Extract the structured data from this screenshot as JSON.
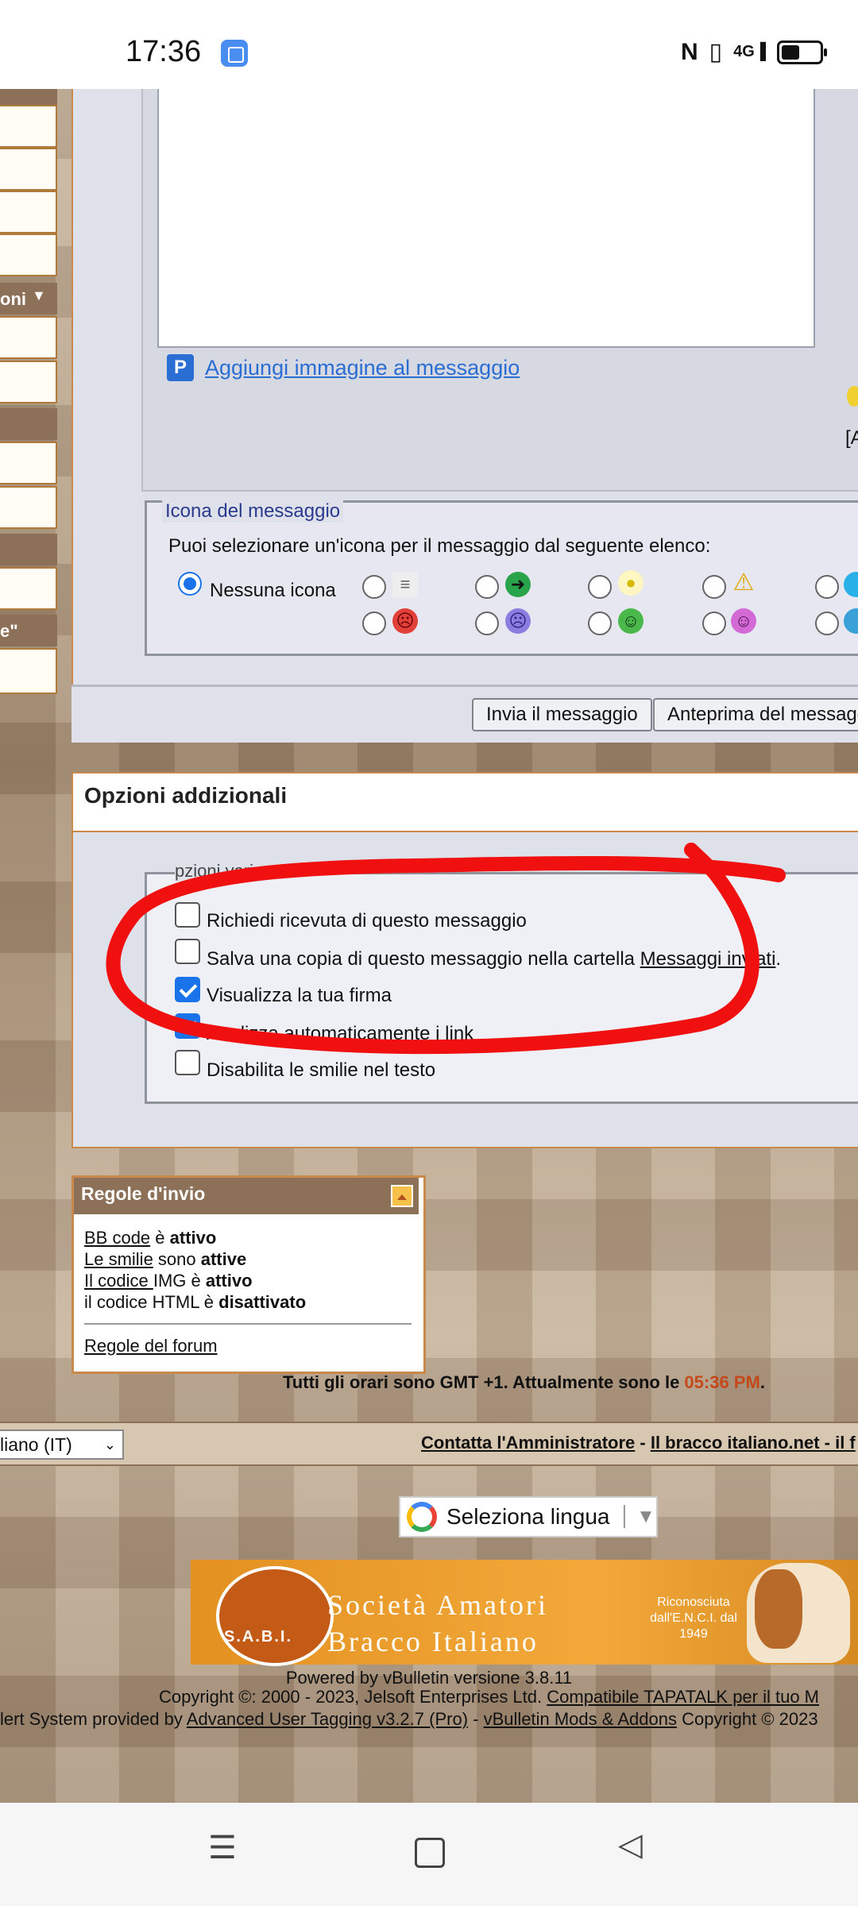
{
  "status_bar": {
    "time": "17:36",
    "network": "4G",
    "icons": [
      "app-notification-icon",
      "nfc-icon",
      "vibrate-icon",
      "signal-icon",
      "battery-icon"
    ]
  },
  "left_column": {
    "label1": "oni",
    "label2": "e\""
  },
  "editor": {
    "add_image_link": "Aggiungi immagine al messaggio",
    "right_label": "[A"
  },
  "message_icon": {
    "legend": "Icona del messaggio",
    "description": "Puoi selezionare un'icona per il messaggio dal seguente elenco:",
    "none_label": "Nessuna icona",
    "icons": [
      "post-icon",
      "right-arrow-icon",
      "lightbulb-icon",
      "exclamation-icon",
      "question-icon",
      "angry-icon",
      "frown-icon",
      "grin-icon",
      "smile-icon",
      "cool-icon"
    ]
  },
  "buttons": {
    "submit": "Invia il messaggio",
    "preview": "Anteprima del messagg"
  },
  "options": {
    "title": "Opzioni addizionali",
    "legend": "pzioni varie",
    "items": [
      {
        "label": "Richiedi ricevuta di questo messaggio",
        "checked": false
      },
      {
        "label": "Salva una copia di questo messaggio nella cartella ",
        "link": "Messaggi inviati",
        "after": ".",
        "checked": false
      },
      {
        "label": "Visualizza la tua firma",
        "checked": true
      },
      {
        "label": "Analizza automaticamente i link",
        "checked": true
      },
      {
        "label": "Disabilita le smilie nel testo",
        "checked": false
      }
    ]
  },
  "rules": {
    "title": "Regole d'invio",
    "line1_link": "BB code",
    "line1_mid": " è ",
    "line1_bold": "attivo",
    "line2_link": "Le smilie",
    "line2_mid": " sono ",
    "line2_bold": "attive",
    "line3_link": "Il codice ",
    "line3_mid": "IMG è ",
    "line3_bold": "attivo",
    "line4_text": "il codice HTML è ",
    "line4_bold": "disattivato",
    "forum_rules": "Regole del forum"
  },
  "time_notice": {
    "text": "Tutti gli orari sono GMT +1. Attualmente sono le ",
    "time": "05:36 PM",
    "end": "."
  },
  "footer": {
    "language": "liano (IT)",
    "contact": "Contatta l'Amministratore",
    "separator": " - ",
    "site": "Il bracco italiano.net - il f",
    "translate": "Seleziona lingua",
    "powered": "Powered by vBulletin versione 3.8.11",
    "copyright_text": "Copyright ©: 2000 - 2023, Jelsoft Enterprises Ltd. ",
    "copyright_link": "Compatibile TAPATALK per il tuo M",
    "alert_pre": "lert System provided by ",
    "alert_link1": "Advanced User Tagging v3.2.7 (Pro)",
    "alert_sep": " - ",
    "alert_link2": "vBulletin Mods & Addons",
    "alert_post": " Copyright © 2023"
  },
  "banner": {
    "logo": "S.A.B.I.",
    "line1": "Società Amatori",
    "line2": "Bracco Italiano",
    "note": "Riconosciuta dall'E.N.C.I. dal 1949"
  }
}
